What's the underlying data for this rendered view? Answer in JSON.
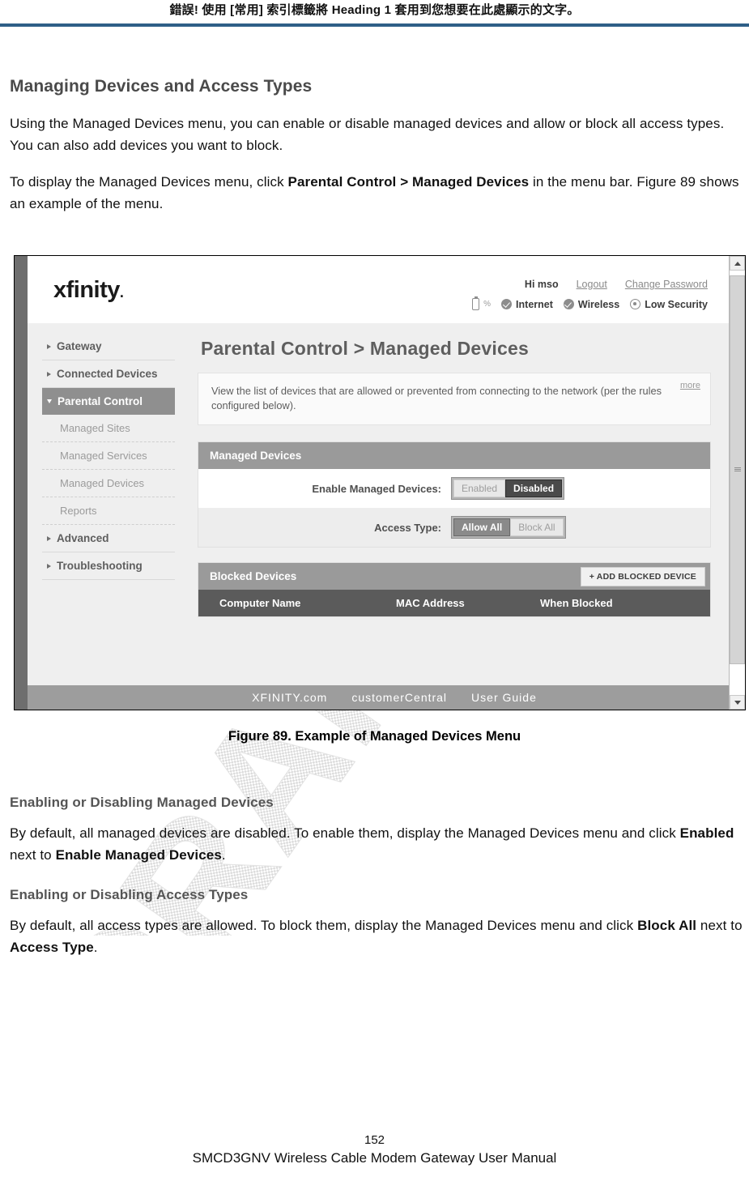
{
  "doc_header": {
    "text": "錯誤! 使用 [常用] 索引標籤將 Heading 1 套用到您想要在此處顯示的文字。",
    "rule_color": "#2e5f87"
  },
  "section": {
    "title": "Managing Devices and Access Types",
    "paragraph1": "Using the Managed Devices menu, you can enable or disable managed devices and allow or block all access types. You can also add devices you want to block.",
    "paragraph2_pre": "To display the Managed Devices menu, click ",
    "paragraph2_bold": "Parental Control > Managed Devices",
    "paragraph2_post": " in the menu bar. Figure 89 shows an example of the menu."
  },
  "figure": {
    "caption": "Figure 89. Example of Managed Devices Menu",
    "logo": "xfinity",
    "account": {
      "greeting": "Hi mso",
      "logout": "Logout",
      "change_password": "Change Password"
    },
    "status": {
      "battery_pct": "%",
      "internet": "Internet",
      "wireless": "Wireless",
      "security": "Low Security"
    },
    "sidebar": [
      {
        "label": "Gateway",
        "type": "top",
        "active": false
      },
      {
        "label": "Connected Devices",
        "type": "top",
        "active": false
      },
      {
        "label": "Parental Control",
        "type": "top",
        "active": true
      },
      {
        "label": "Managed Sites",
        "type": "sub",
        "active": false
      },
      {
        "label": "Managed Services",
        "type": "sub",
        "active": false
      },
      {
        "label": "Managed Devices",
        "type": "sub",
        "active": true
      },
      {
        "label": "Reports",
        "type": "sub",
        "active": false
      },
      {
        "label": "Advanced",
        "type": "top",
        "active": false
      },
      {
        "label": "Troubleshooting",
        "type": "top",
        "active": false
      }
    ],
    "page_heading": "Parental Control > Managed Devices",
    "description": "View the list of devices that are allowed or prevented from connecting to the network (per the rules configured below).",
    "more_link": "more",
    "managed_panel": {
      "title": "Managed Devices",
      "enable_label": "Enable Managed Devices:",
      "enable_option_on": "Enabled",
      "enable_option_off": "Disabled",
      "enable_selected": "Disabled",
      "access_label": "Access Type:",
      "access_option_allow": "Allow All",
      "access_option_block": "Block All",
      "access_selected": "Allow All"
    },
    "blocked_panel": {
      "title": "Blocked Devices",
      "add_button": "+ ADD BLOCKED DEVICE",
      "columns": [
        "Computer Name",
        "MAC Address",
        "When Blocked"
      ],
      "rows": []
    },
    "footer_links": [
      "XFINITY.com",
      "customerCentral",
      "User Guide"
    ]
  },
  "subsection1": {
    "title": "Enabling or Disabling Managed Devices",
    "pre": "By default, all managed devices are disabled. To enable them, display the Managed Devices menu and click ",
    "bold1": "Enabled",
    "mid": " next to ",
    "bold2": "Enable Managed Devices",
    "post": "."
  },
  "subsection2": {
    "title": "Enabling or Disabling Access Types",
    "pre": "By default, all access types are allowed. To block them, display the Managed Devices menu and click ",
    "bold1": "Block All",
    "mid": " next to ",
    "bold2": "Access Type",
    "post": "."
  },
  "watermark": {
    "text": "DRAFT"
  },
  "page_footer": {
    "page_number": "152",
    "manual_title": "SMCD3GNV Wireless Cable Modem Gateway User Manual"
  }
}
